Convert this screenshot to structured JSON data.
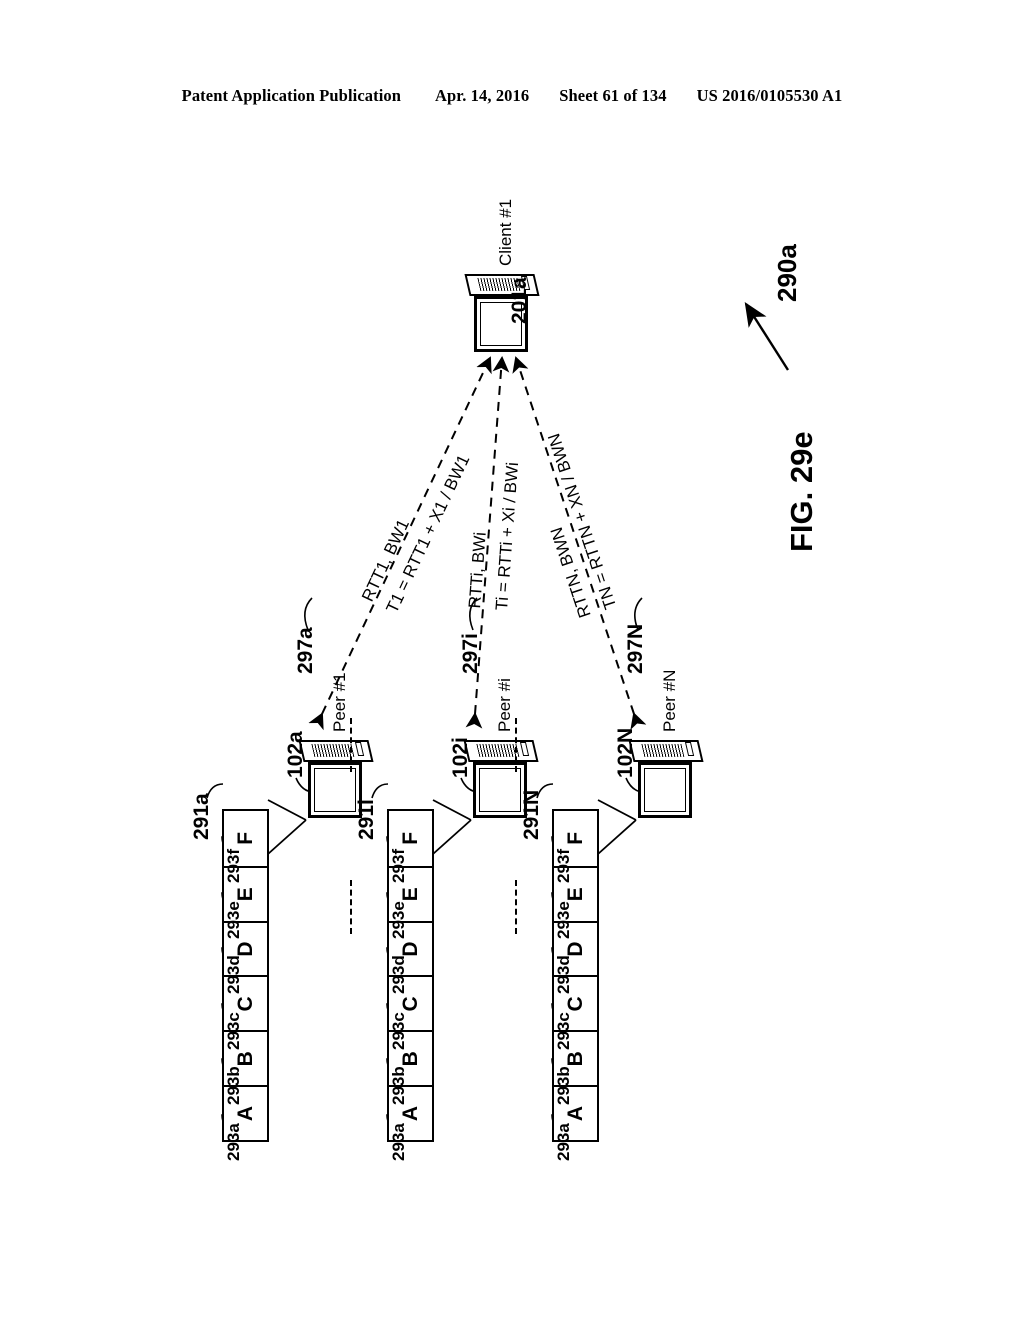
{
  "header": {
    "publication": "Patent Application Publication",
    "date": "Apr. 14, 2016",
    "sheet": "Sheet 61 of 134",
    "patent_number": "US 2016/0105530 A1"
  },
  "figure": {
    "caption": "FIG. 29e",
    "main_reference": "290a"
  },
  "block_labels": [
    "A",
    "B",
    "C",
    "D",
    "E",
    "F"
  ],
  "block_refs": [
    "293a",
    "293b",
    "293c",
    "293d",
    "293e",
    "293f"
  ],
  "rows": [
    {
      "strip_ref": "291a",
      "peer_ref": "102a",
      "peer_name": "Peer #1",
      "arrow_ref": "297a",
      "metric": "RTT1, BW1",
      "formula": "T1 = RTT1 + X1 / BW1"
    },
    {
      "strip_ref": "291i",
      "peer_ref": "102i",
      "peer_name": "Peer #i",
      "arrow_ref": "297i",
      "metric": "RTTi, BWi",
      "formula": "Ti = RTTi + Xi / BWi"
    },
    {
      "strip_ref": "291N",
      "peer_ref": "102N",
      "peer_name": "Peer #N",
      "arrow_ref": "297N",
      "metric": "RTTN, BWN",
      "formula": "TN = RTTN + XN / BWN"
    }
  ],
  "client": {
    "ref": "201a",
    "name": "Client #1"
  }
}
